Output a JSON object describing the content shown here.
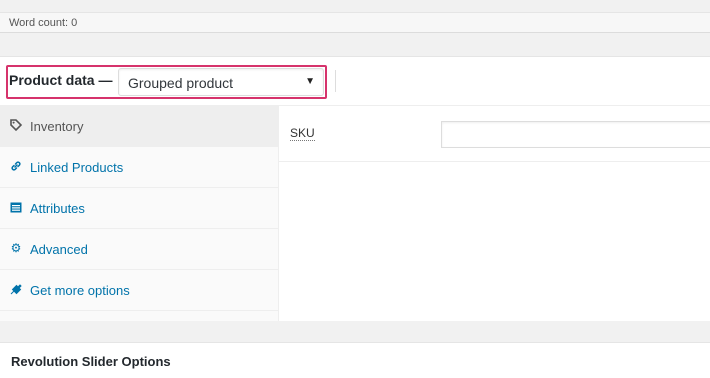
{
  "word_count": {
    "text": "Word count: 0"
  },
  "product_data": {
    "title": "Product data —",
    "type_select": {
      "value": "Grouped product"
    },
    "highlight_color": "#d6336c",
    "tabs": [
      {
        "label": "Inventory",
        "icon": "tag-icon",
        "active": true
      },
      {
        "label": "Linked Products",
        "icon": "link-icon",
        "active": false
      },
      {
        "label": "Attributes",
        "icon": "list-table-icon",
        "active": false
      },
      {
        "label": "Advanced",
        "icon": "gear-icon",
        "active": false
      },
      {
        "label": "Get more options",
        "icon": "plugin-icon",
        "active": false
      }
    ],
    "inventory": {
      "sku_label": "SKU",
      "sku_value": ""
    }
  },
  "revolution_slider": {
    "title": "Revolution Slider Options"
  },
  "colors": {
    "link": "#0073aa",
    "background": "#f1f1f1"
  }
}
